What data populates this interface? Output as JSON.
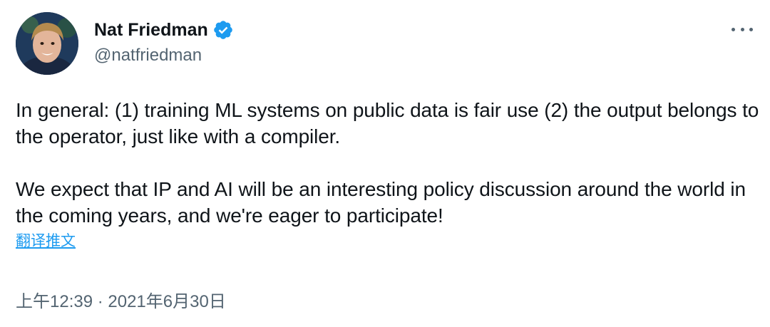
{
  "author": {
    "name": "Nat Friedman",
    "handle": "@natfriedman",
    "verified": true
  },
  "tweet": {
    "paragraphs": [
      "In general: (1) training ML systems on public data is fair use (2) the output belongs to the operator, just like with a compiler.",
      "We expect that IP and AI will be an interesting policy discussion around the world in the coming years, and we're eager to participate!"
    ],
    "translate_label": "翻译推文",
    "timestamp": "上午12:39 · 2021年6月30日"
  },
  "icons": {
    "verified": "verified-badge-icon",
    "more": "more-options-icon"
  },
  "colors": {
    "text": "#0f1419",
    "secondary": "#536471",
    "link": "#1d9bf0",
    "verified": "#1d9bf0"
  }
}
